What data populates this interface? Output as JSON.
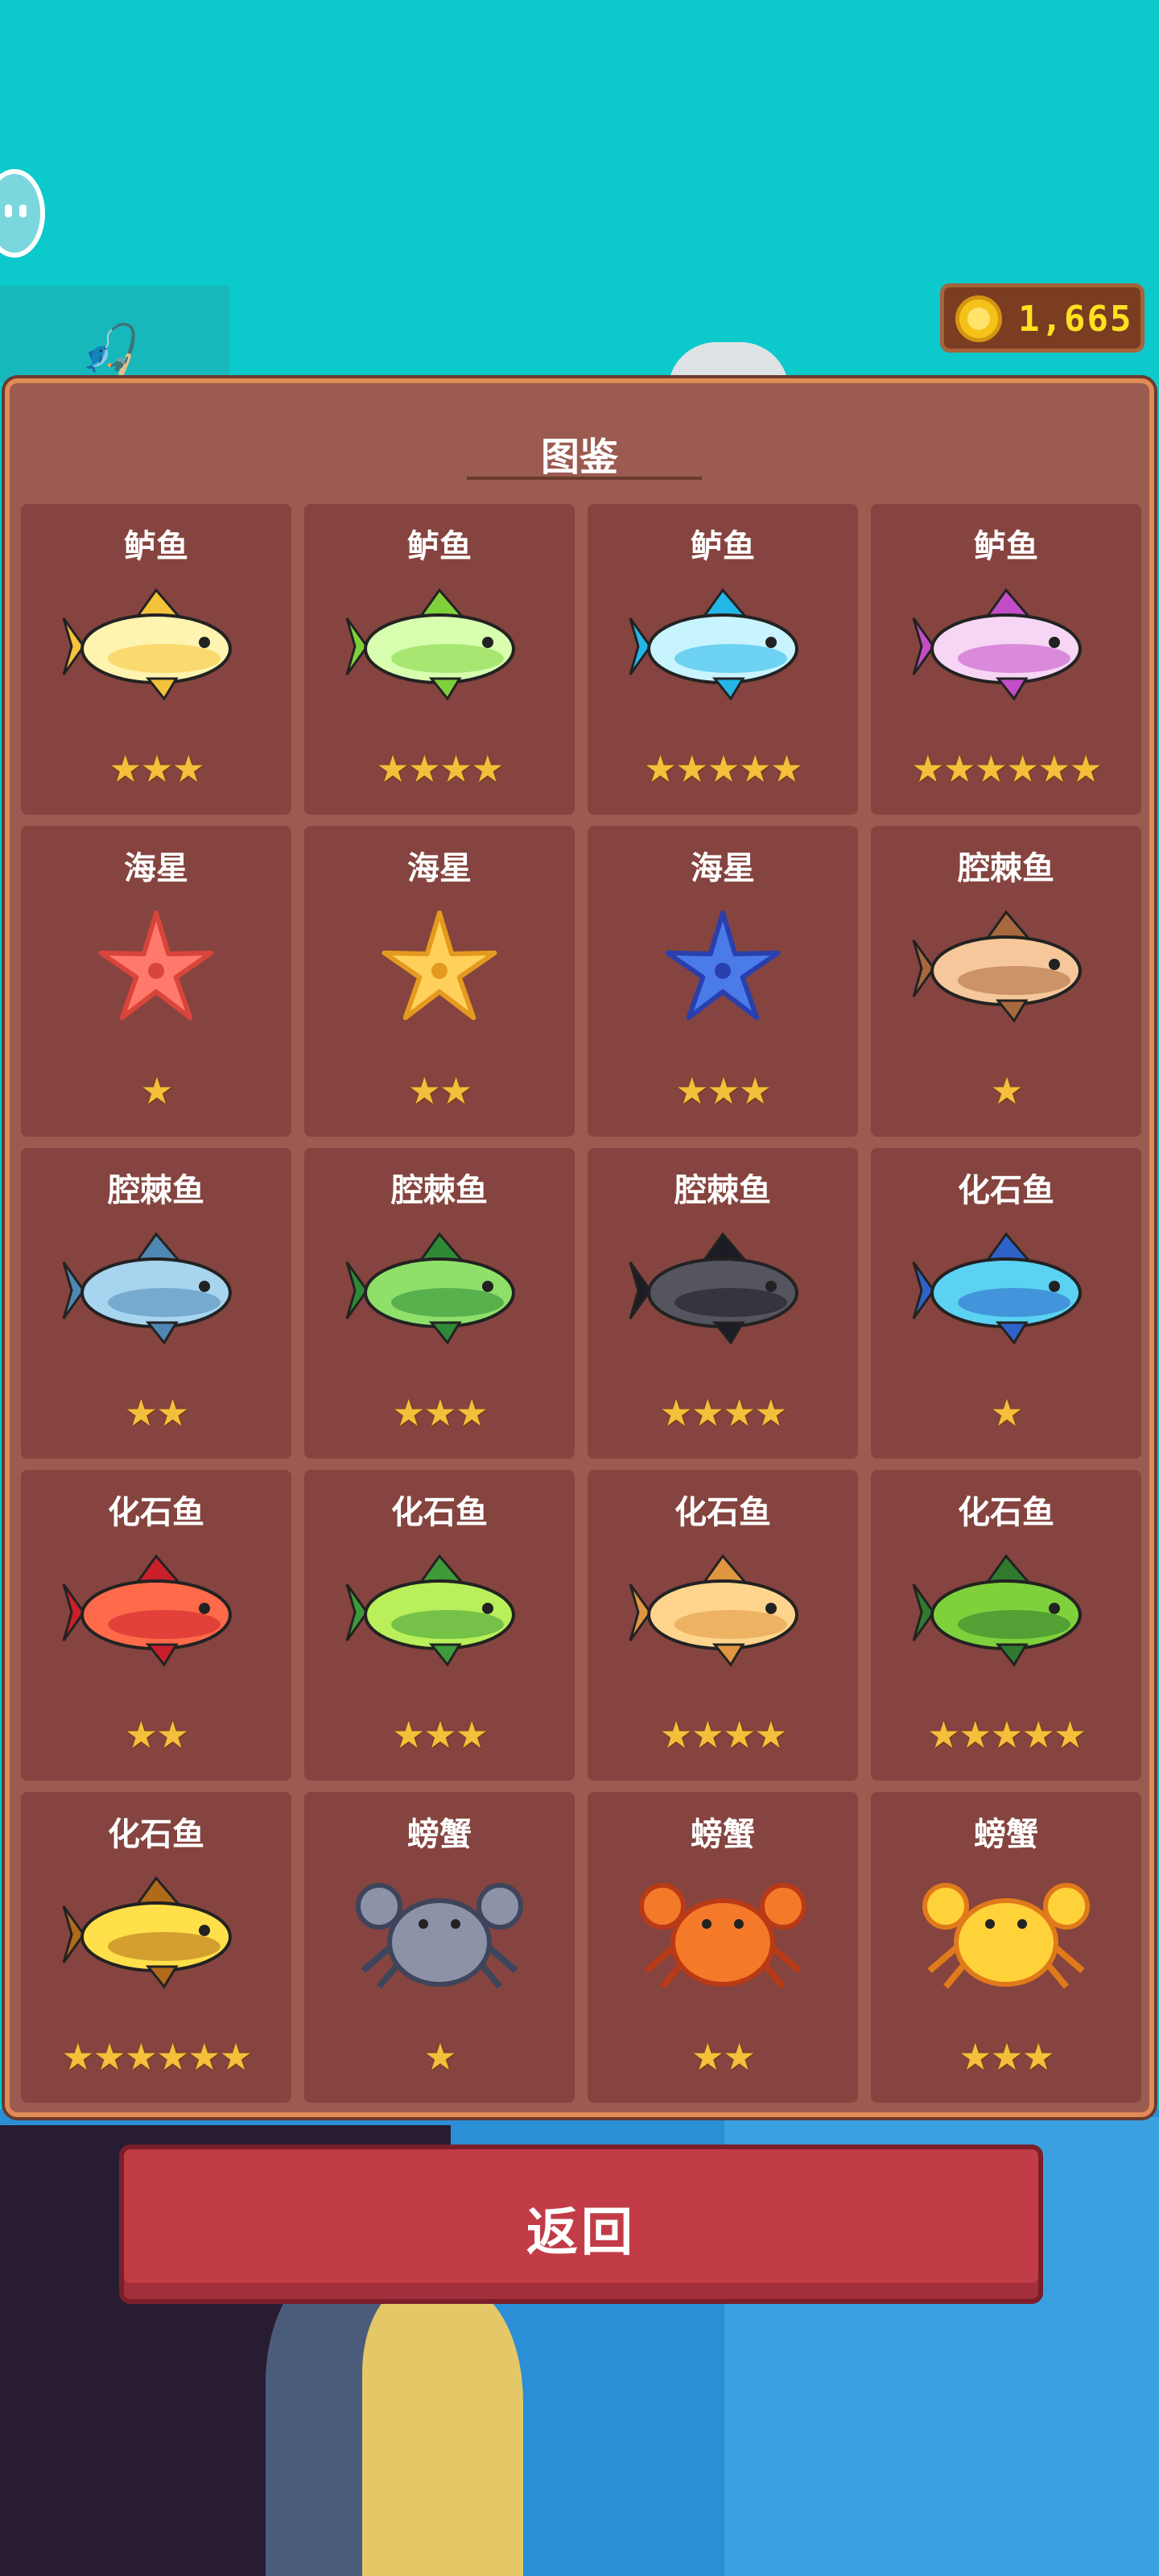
{
  "coins": {
    "amount": "1,665"
  },
  "panel": {
    "title": "图鉴"
  },
  "back_button": {
    "label": "返回"
  },
  "colors": {
    "sky": "#0cc9cc",
    "panel": "#9b5b50",
    "card": "#85443f",
    "star": "#f4bf3a",
    "button": "#c13c47",
    "coin_text": "#ffe11f"
  },
  "cards": [
    {
      "name": "鲈鱼",
      "stars": "★★★",
      "creature": "fish",
      "colors": [
        "#fff3b0",
        "#f5c33a"
      ]
    },
    {
      "name": "鲈鱼",
      "stars": "★★★★",
      "creature": "fish",
      "colors": [
        "#d8ffb0",
        "#7fd13c"
      ]
    },
    {
      "name": "鲈鱼",
      "stars": "★★★★★",
      "creature": "fish",
      "colors": [
        "#c8f4ff",
        "#25b6e8"
      ]
    },
    {
      "name": "鲈鱼",
      "stars": "★★★★★★",
      "creature": "fish",
      "colors": [
        "#f6d6f4",
        "#c24dc6"
      ]
    },
    {
      "name": "海星",
      "stars": "★",
      "creature": "starfish",
      "colors": [
        "#ff7a6a",
        "#d9443b"
      ]
    },
    {
      "name": "海星",
      "stars": "★★",
      "creature": "starfish",
      "colors": [
        "#ffd15a",
        "#e49a1e"
      ]
    },
    {
      "name": "海星",
      "stars": "★★★",
      "creature": "starfish",
      "colors": [
        "#4a7be8",
        "#2a3fae"
      ]
    },
    {
      "name": "腔棘鱼",
      "stars": "★",
      "creature": "fish",
      "colors": [
        "#f6c79a",
        "#a8683e"
      ]
    },
    {
      "name": "腔棘鱼",
      "stars": "★★",
      "creature": "fish",
      "colors": [
        "#a7d4ef",
        "#4f87b3"
      ]
    },
    {
      "name": "腔棘鱼",
      "stars": "★★★",
      "creature": "fish",
      "colors": [
        "#8fe06a",
        "#2e8a36"
      ]
    },
    {
      "name": "腔棘鱼",
      "stars": "★★★★",
      "creature": "fish",
      "colors": [
        "#555560",
        "#1c1c24"
      ]
    },
    {
      "name": "化石鱼",
      "stars": "★",
      "creature": "fish",
      "colors": [
        "#5bd2f2",
        "#2e62c8"
      ]
    },
    {
      "name": "化石鱼",
      "stars": "★★",
      "creature": "fish",
      "colors": [
        "#ff6a4a",
        "#c91f2a"
      ]
    },
    {
      "name": "化石鱼",
      "stars": "★★★",
      "creature": "fish",
      "colors": [
        "#b8ef5a",
        "#3f9a3a"
      ]
    },
    {
      "name": "化石鱼",
      "stars": "★★★★",
      "creature": "fish",
      "colors": [
        "#ffd58e",
        "#e09640"
      ]
    },
    {
      "name": "化石鱼",
      "stars": "★★★★★",
      "creature": "fish",
      "colors": [
        "#7fd13c",
        "#2f7a2e"
      ]
    },
    {
      "name": "化石鱼",
      "stars": "★★★★★★",
      "creature": "fish",
      "colors": [
        "#ffe04a",
        "#b06a1a"
      ]
    },
    {
      "name": "螃蟹",
      "stars": "★",
      "creature": "crab",
      "colors": [
        "#8c93a8",
        "#3e445c"
      ]
    },
    {
      "name": "螃蟹",
      "stars": "★★",
      "creature": "crab",
      "colors": [
        "#f47a2a",
        "#b83a16"
      ]
    },
    {
      "name": "螃蟹",
      "stars": "★★★",
      "creature": "crab",
      "colors": [
        "#ffd23a",
        "#e07a1a"
      ]
    }
  ]
}
